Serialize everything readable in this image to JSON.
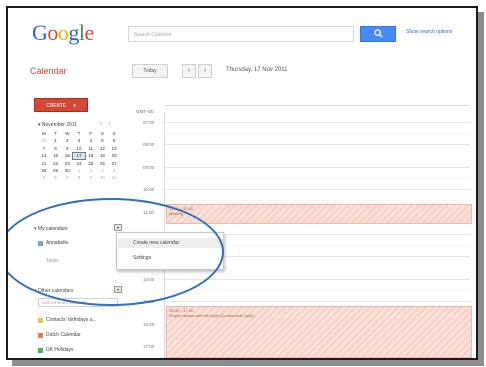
{
  "header": {
    "logo": "Google",
    "search_placeholder": "Search Calendar",
    "search_button_icon": "magnifier-icon",
    "search_options": "Show search options"
  },
  "app_title": "Calendar",
  "toolbar": {
    "today": "Today",
    "prev": "‹",
    "next": "›",
    "date_heading": "Thursday, 17 Nov 2011"
  },
  "create_button": "CREATE",
  "mini_calendar": {
    "month": "November 2011",
    "prev": "‹",
    "next": "›",
    "weekdays": [
      "M",
      "T",
      "W",
      "T",
      "F",
      "S",
      "S"
    ],
    "days": [
      [
        "31",
        "1",
        "2",
        "3",
        "4",
        "5",
        "6"
      ],
      [
        "7",
        "8",
        "9",
        "10",
        "11",
        "12",
        "13"
      ],
      [
        "14",
        "15",
        "16",
        "17",
        "18",
        "19",
        "20"
      ],
      [
        "21",
        "22",
        "23",
        "24",
        "25",
        "26",
        "27"
      ],
      [
        "28",
        "29",
        "30",
        "1",
        "2",
        "3",
        "4"
      ],
      [
        "5",
        "6",
        "7",
        "8",
        "9",
        "10",
        "11"
      ]
    ]
  },
  "my_calendars": {
    "heading": "My calendars",
    "toggle": "▾",
    "items": [
      {
        "label": "Annabelle",
        "color": "#7aa3e5"
      }
    ],
    "sub_item": "Tasks"
  },
  "context_menu": {
    "items": [
      "Create new calendar",
      "Settings"
    ]
  },
  "other_calendars": {
    "heading": "Other calendars",
    "toggle": "▾",
    "add_placeholder": "Add a friend's calendar",
    "items": [
      {
        "label": "Contacts' birthdays a...",
        "color": "#f2c14e"
      },
      {
        "label": "Dutch Calendar",
        "color": "#e67c4d"
      },
      {
        "label": "UK Holidays",
        "color": "#4caf50"
      }
    ]
  },
  "day_view": {
    "allday_label": "GMT+00",
    "times": [
      "07:00",
      "08:00",
      "09:00",
      "10:00",
      "11:00",
      "12:00",
      "13:00",
      "14:00",
      "15:00",
      "16:00",
      "17:00"
    ],
    "events": [
      {
        "time": "11:00 – 12:00",
        "title": "Meeting"
      },
      {
        "time": "15:00 – 17:00",
        "title": "Project review with the team (Conference room)"
      }
    ]
  },
  "colors": {
    "accent_red": "#d14836",
    "search_blue": "#4a8af4",
    "annotation": "#2e6fbf",
    "event_fill": "#f9d3c7"
  }
}
